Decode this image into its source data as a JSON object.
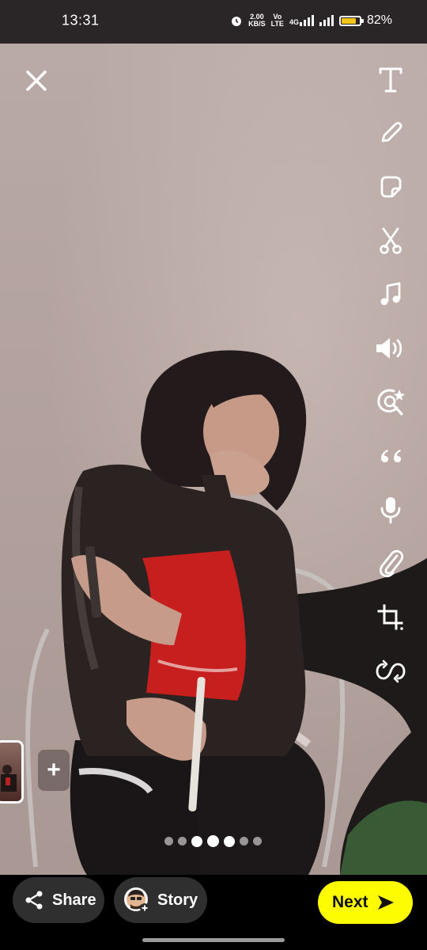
{
  "status_bar": {
    "time": "13:31",
    "speed_value": "2.00",
    "speed_unit": "KB/S",
    "volte_top": "Vo",
    "volte_bottom": "LTE",
    "network": "4G",
    "battery_percent": "82%",
    "battery_level": 0.82
  },
  "toolbar": {
    "icons": [
      "text-icon",
      "pencil-icon",
      "sticker-icon",
      "scissors-icon",
      "music-icon",
      "sound-icon",
      "lens-search-icon",
      "quote-icon",
      "microphone-icon",
      "paperclip-icon",
      "crop-icon",
      "loop-icon"
    ]
  },
  "editor": {
    "add_label": "+",
    "page_dots": 7,
    "active_dot": 3
  },
  "actions": {
    "share_label": "Share",
    "story_label": "Story",
    "next_label": "Next"
  },
  "colors": {
    "next_bg": "#fffc00",
    "pill_bg": "#2f2f2f",
    "battery": "#f5c518"
  }
}
